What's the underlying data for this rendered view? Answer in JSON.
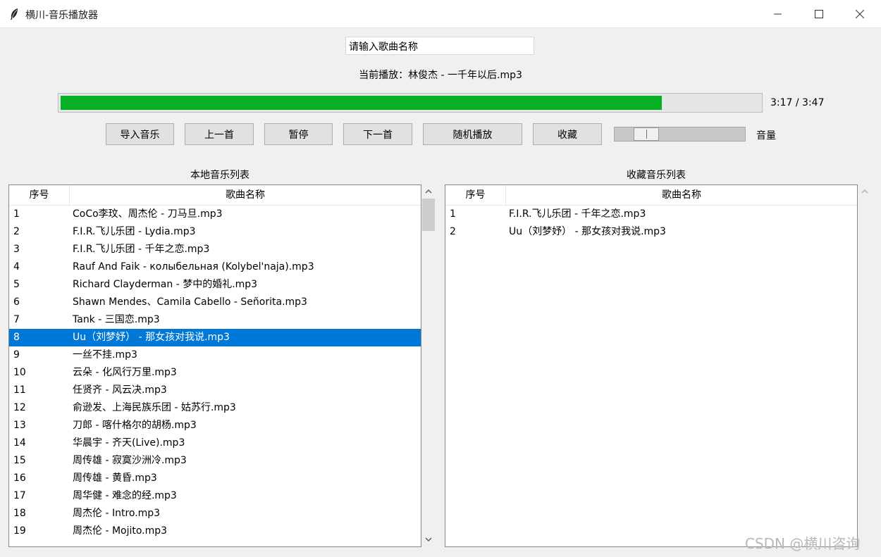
{
  "window": {
    "title": "横川-音乐播放器",
    "icons": [
      "feather-icon",
      "minimize-icon",
      "maximize-icon",
      "close-icon"
    ]
  },
  "search": {
    "value": "请输入歌曲名称"
  },
  "now_playing": "当前播放：林俊杰 - 一千年以后.mp3",
  "progress": {
    "fraction": 0.86,
    "time_text": "3:17 / 3:47",
    "fill_color": "#06b025"
  },
  "controls": {
    "import_label": "导入音乐",
    "prev_label": "上一首",
    "pause_label": "暂停",
    "next_label": "下一首",
    "shuffle_label": "随机播放",
    "favorite_label": "收藏",
    "volume_label": "音量",
    "volume_level": 0.18
  },
  "local_list": {
    "title": "本地音乐列表",
    "columns": [
      "序号",
      "歌曲名称"
    ],
    "selected_index": 7,
    "selected_color": "#0078d7",
    "rows": [
      {
        "num": "1",
        "song": "CoCo李玟、周杰伦 - 刀马旦.mp3"
      },
      {
        "num": "2",
        "song": "F.I.R.飞儿乐团 - Lydia.mp3"
      },
      {
        "num": "3",
        "song": "F.I.R.飞儿乐团 - 千年之恋.mp3"
      },
      {
        "num": "4",
        "song": "Rauf And Faik - колыбельная (Kolybel'naja).mp3"
      },
      {
        "num": "5",
        "song": "Richard Clayderman - 梦中的婚礼.mp3"
      },
      {
        "num": "6",
        "song": "Shawn Mendes、Camila Cabello - Señorita.mp3"
      },
      {
        "num": "7",
        "song": "Tank - 三国恋.mp3"
      },
      {
        "num": "8",
        "song": "Uu（刘梦妤） - 那女孩对我说.mp3"
      },
      {
        "num": "9",
        "song": "一丝不挂.mp3"
      },
      {
        "num": "10",
        "song": "云朵 - 化风行万里.mp3"
      },
      {
        "num": "11",
        "song": "任贤齐 - 风云决.mp3"
      },
      {
        "num": "12",
        "song": "俞逊发、上海民族乐团 - 姑苏行.mp3"
      },
      {
        "num": "13",
        "song": "刀郎 - 喀什格尔的胡杨.mp3"
      },
      {
        "num": "14",
        "song": "华晨宇 - 齐天(Live).mp3"
      },
      {
        "num": "15",
        "song": "周传雄 - 寂寞沙洲冷.mp3"
      },
      {
        "num": "16",
        "song": "周传雄 - 黄昏.mp3"
      },
      {
        "num": "17",
        "song": "周华健 - 难念的经.mp3"
      },
      {
        "num": "18",
        "song": "周杰伦 - Intro.mp3"
      },
      {
        "num": "19",
        "song": "周杰伦 - Mojito.mp3"
      }
    ]
  },
  "fav_list": {
    "title": "收藏音乐列表",
    "columns": [
      "序号",
      "歌曲名称"
    ],
    "rows": [
      {
        "num": "1",
        "song": "F.I.R.飞儿乐团 - 千年之恋.mp3"
      },
      {
        "num": "2",
        "song": "Uu（刘梦妤） - 那女孩对我说.mp3"
      }
    ]
  },
  "watermark": "CSDN @横川咨询"
}
